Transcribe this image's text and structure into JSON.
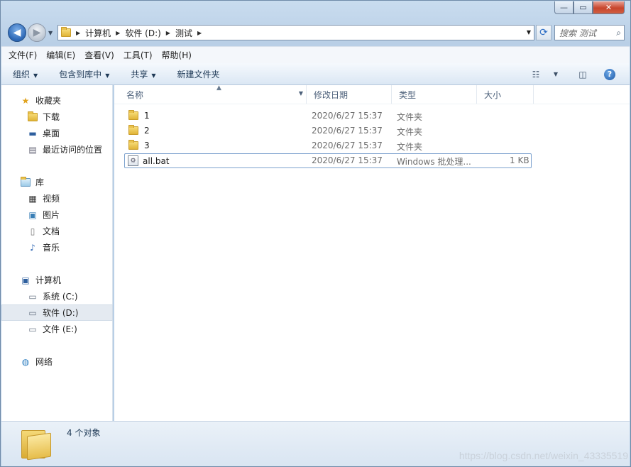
{
  "window": {
    "buttons": {
      "minimize": "—",
      "maximize": "▭",
      "close": "✕"
    }
  },
  "nav": {
    "breadcrumb": [
      "计算机",
      "软件 (D:)",
      "测试"
    ],
    "search_placeholder": "搜索 测试"
  },
  "menu": [
    "文件(F)",
    "编辑(E)",
    "查看(V)",
    "工具(T)",
    "帮助(H)"
  ],
  "toolbar": {
    "organize": "组织",
    "include_library": "包含到库中",
    "share": "共享",
    "new_folder": "新建文件夹"
  },
  "navpane": {
    "favorites": "收藏夹",
    "downloads": "下载",
    "desktop": "桌面",
    "recent": "最近访问的位置",
    "libraries": "库",
    "videos": "视频",
    "pictures": "图片",
    "documents": "文档",
    "music": "音乐",
    "computer": "计算机",
    "drive_c": "系统 (C:)",
    "drive_d": "软件 (D:)",
    "drive_e": "文件 (E:)",
    "network": "网络"
  },
  "columns": {
    "name": "名称",
    "modified": "修改日期",
    "type": "类型",
    "size": "大小"
  },
  "files": [
    {
      "name": "1",
      "modified": "2020/6/27 15:37",
      "type": "文件夹",
      "size": ""
    },
    {
      "name": "2",
      "modified": "2020/6/27 15:37",
      "type": "文件夹",
      "size": ""
    },
    {
      "name": "3",
      "modified": "2020/6/27 15:37",
      "type": "文件夹",
      "size": ""
    },
    {
      "name": "all.bat",
      "modified": "2020/6/27 15:37",
      "type": "Windows 批处理...",
      "size": "1 KB"
    }
  ],
  "status": {
    "count": "4 个对象"
  },
  "watermark": "https://blog.csdn.net/weixin_43335519"
}
